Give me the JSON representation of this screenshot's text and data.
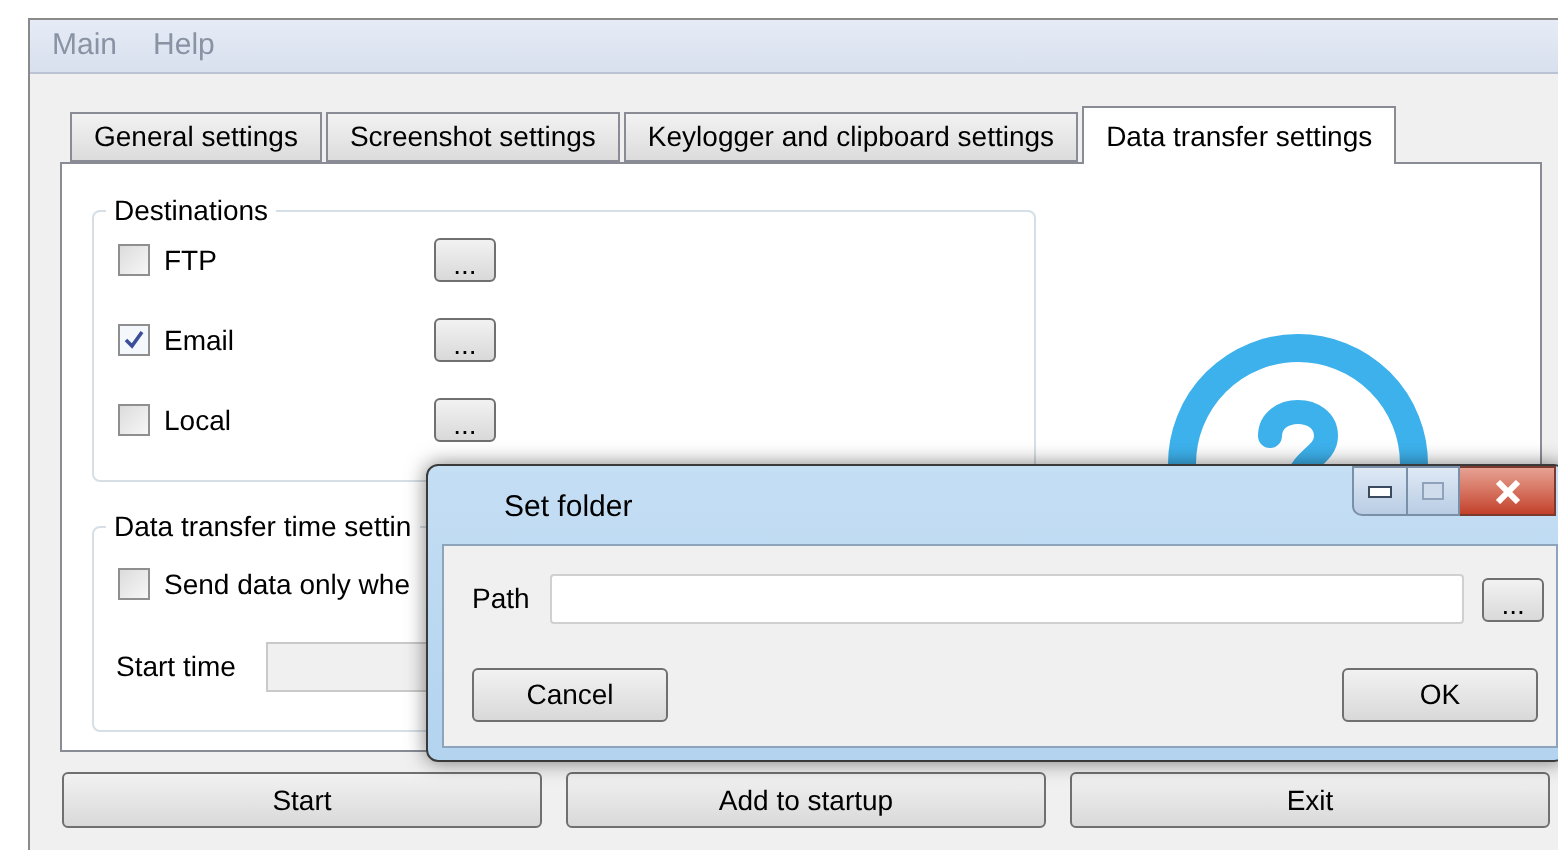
{
  "menu": [
    "Main",
    "Help"
  ],
  "tabs": [
    {
      "label": "General settings",
      "selected": false
    },
    {
      "label": "Screenshot settings",
      "selected": false
    },
    {
      "label": "Keylogger and clipboard settings",
      "selected": false
    },
    {
      "label": "Data transfer settings",
      "selected": true
    }
  ],
  "destinations": {
    "title": "Destinations",
    "items": [
      {
        "label": "FTP",
        "checked": false,
        "button": "..."
      },
      {
        "label": "Email",
        "checked": true,
        "button": "..."
      },
      {
        "label": "Local",
        "checked": false,
        "button": "..."
      }
    ]
  },
  "time_settings": {
    "title": "Data transfer time settin",
    "send_only": {
      "label": "Send data only whe",
      "checked": false
    },
    "start_time_label": "Start time"
  },
  "buttons": [
    "Start",
    "Add to startup",
    "Exit"
  ],
  "dialog": {
    "title": "Set folder",
    "path_label": "Path",
    "browse": "...",
    "buttons": [
      "Cancel",
      "OK"
    ]
  }
}
